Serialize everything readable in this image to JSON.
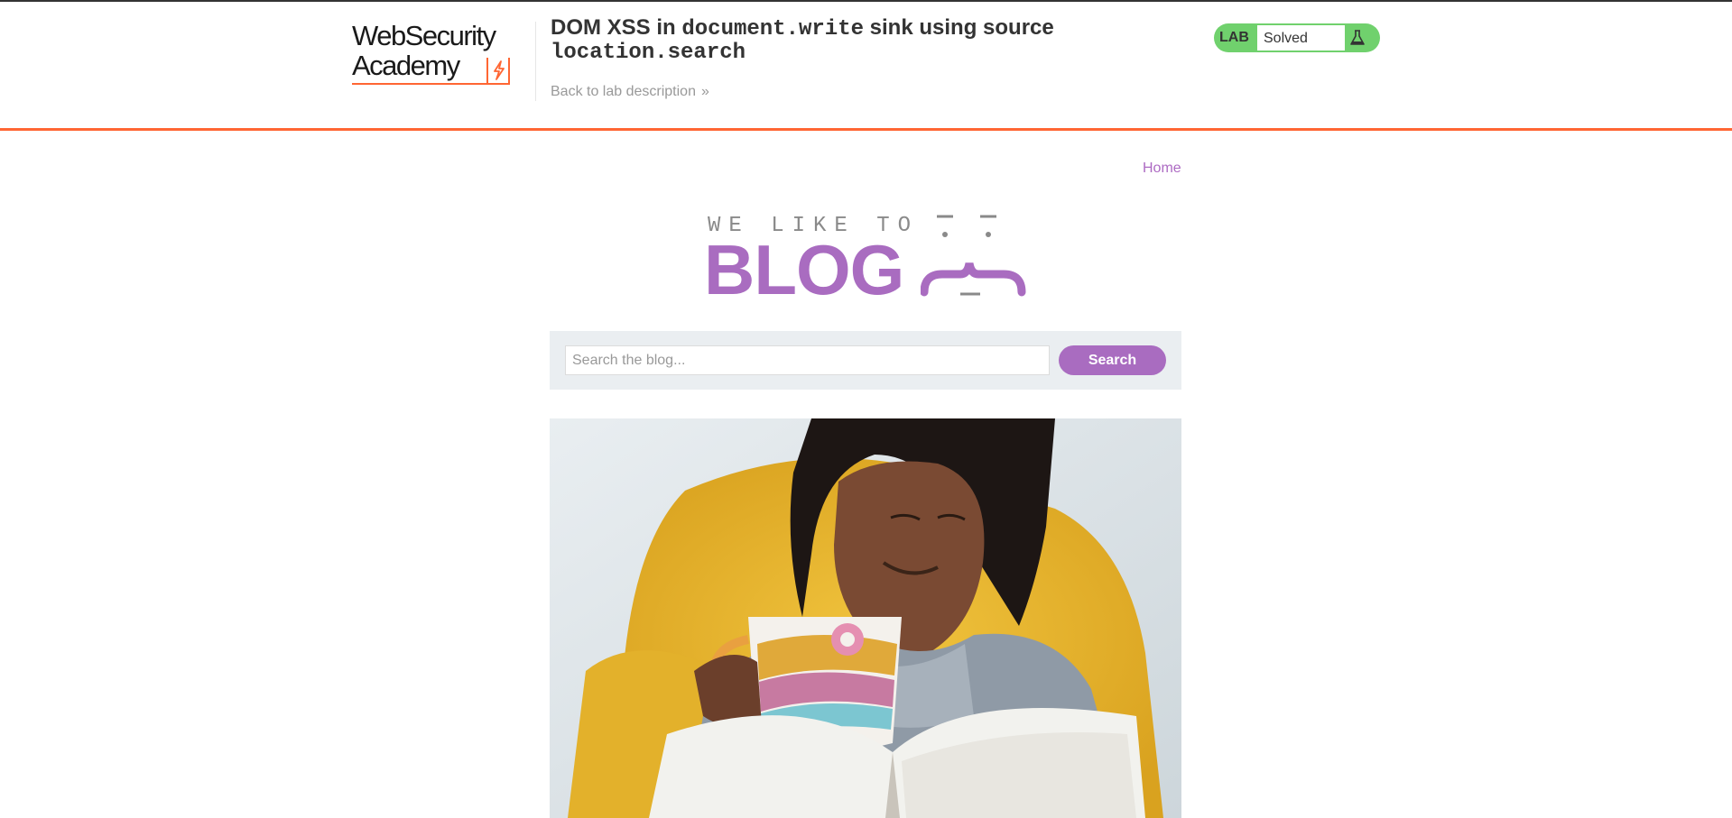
{
  "lab_header": {
    "logo_line1": "WebSecurity",
    "logo_line2": "Academy",
    "title_prefix": "DOM XSS in ",
    "title_code1": "document.write",
    "title_middle": " sink using source ",
    "title_code2": "location.search",
    "back_link": "Back to lab description",
    "status_label": "LAB",
    "status_value": "Solved",
    "accent_color": "#ff6633",
    "status_color": "#70d16d"
  },
  "nav": {
    "home": "Home"
  },
  "banner": {
    "small": "WE LIKE TO",
    "big": "BLOG"
  },
  "search": {
    "placeholder": "Search the blog...",
    "value": "",
    "button": "Search"
  },
  "colors": {
    "brand_purple": "#a96cc0"
  },
  "icons": [
    "flask-icon",
    "chevron-right-icon",
    "bolt-icon"
  ]
}
